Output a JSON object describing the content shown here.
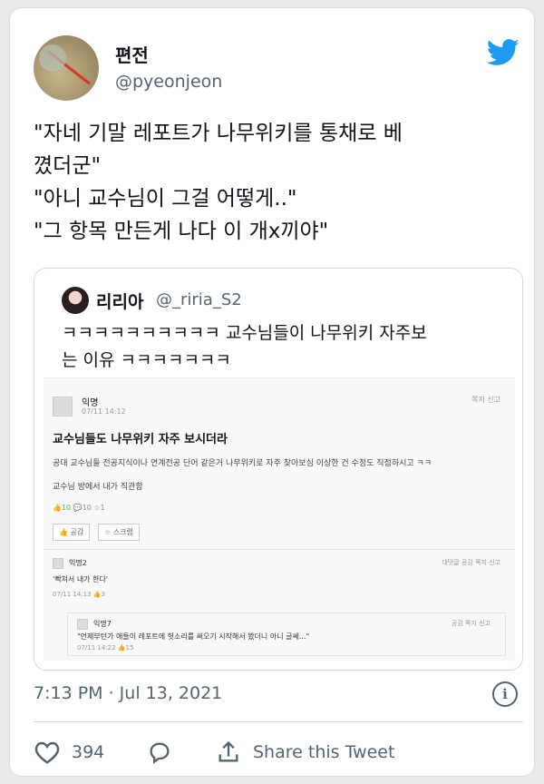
{
  "author": {
    "name": "편전",
    "handle": "@pyeonjeon"
  },
  "tweet_lines": [
    "\"자네 기말 레포트가 나무위키를 통채로 베",
    "꼈더군\"",
    "\"아니 교수님이 그걸 어떻게..\"",
    "\"그 항목 만든게 나다 이 개x끼야\""
  ],
  "quote": {
    "name": "리리아",
    "handle": "@_riria_S2",
    "text_lines": [
      "ㅋㅋㅋㅋㅋㅋㅋㅋㅋㅋ 교수님들이 나무위키 자주보",
      "는 이유 ㅋㅋㅋㅋㅋㅋㅋ"
    ],
    "post": {
      "author": "익명",
      "date": "07/11 14:12",
      "actions": "쪽지  신고",
      "title": "교수님들도 나무위키 자주 보시더라",
      "line1": "공대 교수님들 전공지식이나 연계전공 단어 같은거 나무위키로 자주 찾아보심 이상한 건 수정도 직접하시고 ㅋㅋ",
      "line2": "교수님 방에서 내가 직관함",
      "stats": "👍10  💬10  ☆1",
      "btn_like": "👍 공감",
      "btn_scrap": "☆ 스크랩",
      "comment1": {
        "name": "익명2",
        "text": "'빡쳐서 내가 한다'",
        "meta": "07/11 14:13  👍3",
        "actions": "대댓글  공감  쪽지  신고"
      },
      "comment2": {
        "name": "익명7",
        "text": "\"언제부턴가 애들이 레포트에 헛소리를 써오기 시작해서 봤더니 아니 글쎄...\"",
        "meta": "07/11 14:22  👍15",
        "actions": "공감  쪽지  신고"
      }
    }
  },
  "timestamp": "7:13 PM · Jul 13, 2021",
  "likes": "394",
  "share_label": "Share this Tweet",
  "colors": {
    "twitter_blue": "#1d9bf0",
    "secondary_text": "#536471"
  }
}
